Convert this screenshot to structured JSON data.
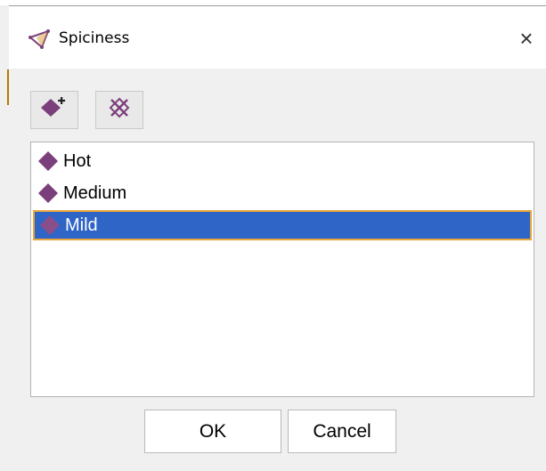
{
  "dialog": {
    "title": "Spiciness",
    "title_icon": "triangle-app-icon",
    "close_glyph": "×"
  },
  "toolbar": {
    "add_icon": "add-diamond-icon",
    "remove_icon": "remove-diamond-icon"
  },
  "list": {
    "items": [
      {
        "label": "Hot",
        "selected": false
      },
      {
        "label": "Medium",
        "selected": false
      },
      {
        "label": "Mild",
        "selected": true
      }
    ]
  },
  "buttons": {
    "ok_label": "OK",
    "cancel_label": "Cancel"
  },
  "colors": {
    "diamond": "#7b3f7b",
    "selection": "#2f65c6",
    "selection_border": "#e8a53a"
  }
}
